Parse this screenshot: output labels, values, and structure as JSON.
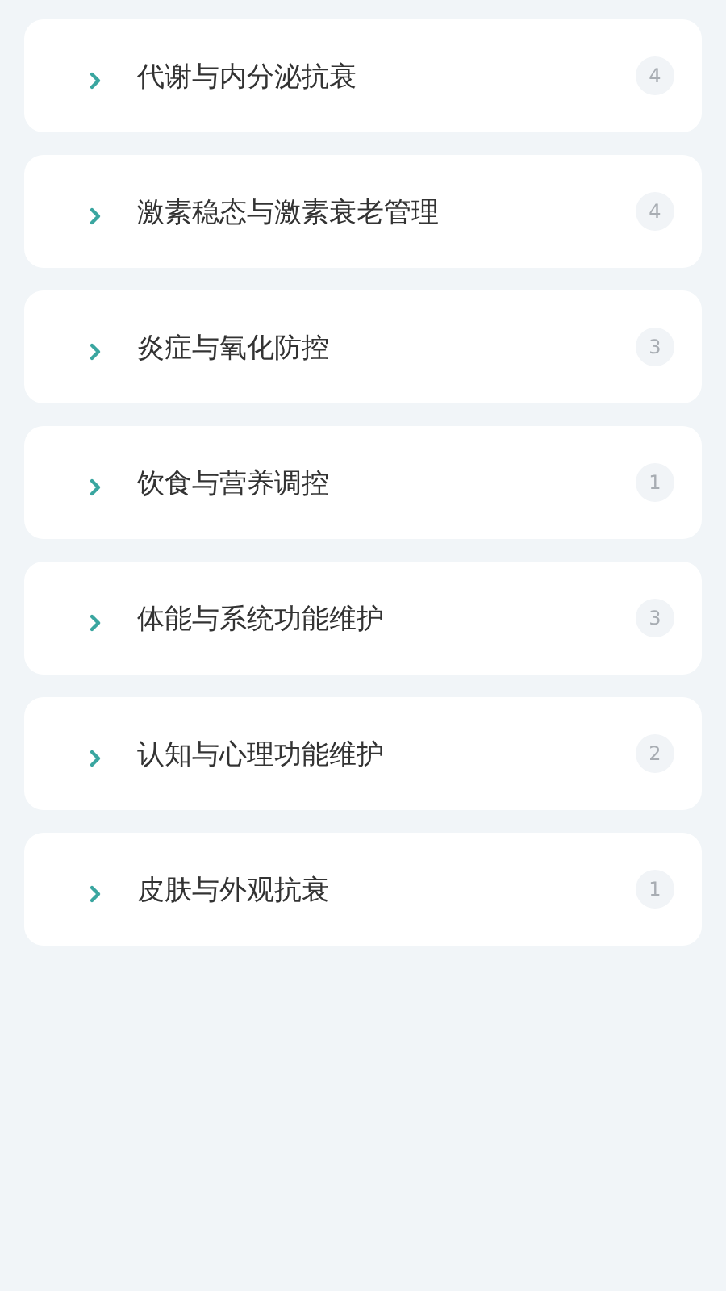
{
  "categories": [
    {
      "title": "代谢与内分泌抗衰",
      "count": "4",
      "expanded": false
    },
    {
      "title": "激素稳态与激素衰老管理",
      "count": "4",
      "expanded": false
    },
    {
      "title": "炎症与氧化防控",
      "count": "3",
      "expanded": false
    },
    {
      "title": "饮食与营养调控",
      "count": "1",
      "expanded": false
    },
    {
      "title": "体能与系统功能维护",
      "count": "3",
      "expanded": false
    },
    {
      "title": "认知与心理功能维护",
      "count": "2",
      "expanded": false
    },
    {
      "title": "皮肤与外观抗衰",
      "count": "1",
      "expanded": false
    }
  ]
}
